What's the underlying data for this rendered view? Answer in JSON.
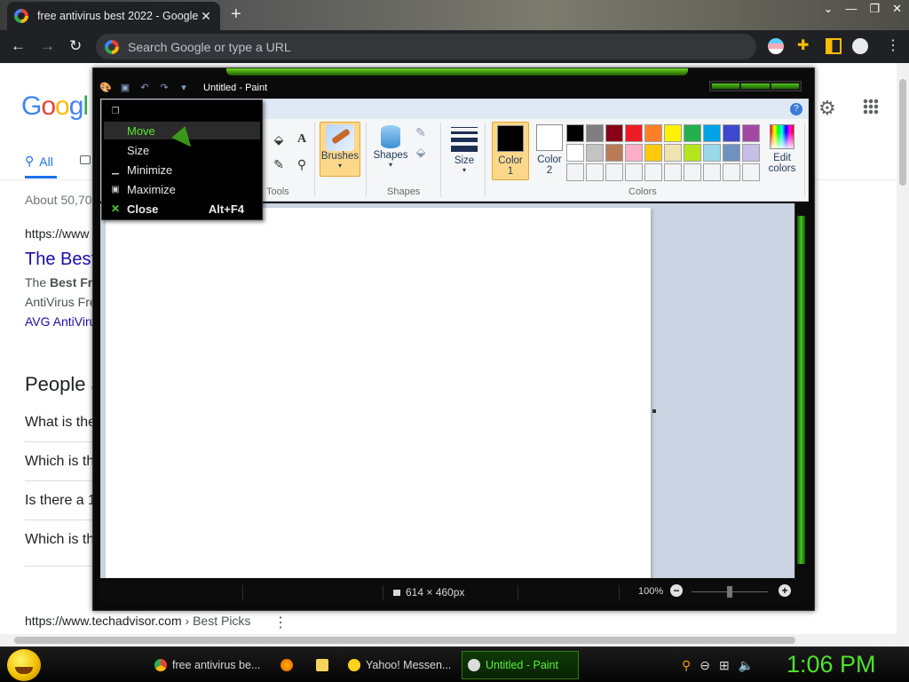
{
  "browser": {
    "tab_title": "free antivirus best 2022 - Google",
    "tab_close": "✕",
    "new_tab": "+",
    "omnibox_placeholder": "Search Google or type a URL",
    "back": "←",
    "forward": "→",
    "reload": "↻"
  },
  "google": {
    "logo": [
      "G",
      "o",
      "o",
      "g",
      "l"
    ],
    "tab_all": "All",
    "about": "About 50,70",
    "result_url": "https://www",
    "result_title": "The Best",
    "snippet_prefix": "The ",
    "snippet_bold": "Best Fre",
    "snippet_line2": "AntiVirus Fre",
    "result_link": "AVG AntiViru",
    "people_also_ask": "People a",
    "questions": [
      "What is the",
      "Which is th",
      "Is there a 1",
      "Which is th"
    ],
    "result2_url": "https://www.techadvisor.com",
    "result2_crumb": " › Best Picks",
    "kebab": "⋮"
  },
  "paint": {
    "window_title": "Untitled - Paint",
    "groups": {
      "tools": "Tools",
      "shapes": "Shapes",
      "colors": "Colors"
    },
    "buttons": {
      "brushes": "Brushes",
      "shapes": "Shapes",
      "size": "Size",
      "color1": "Color",
      "color1_num": "1",
      "color2": "Color",
      "color2_num": "2",
      "edit_colors_1": "Edit",
      "edit_colors_2": "colors"
    },
    "palette": [
      "#000000",
      "#7f7f7f",
      "#880015",
      "#ed1c24",
      "#ff7f27",
      "#fff200",
      "#22b14c",
      "#00a2e8",
      "#3f48cc",
      "#a349a4",
      "#ffffff",
      "#c3c3c3",
      "#b97a57",
      "#ffaec9",
      "#ffc90e",
      "#efe4b0",
      "#b5e61d",
      "#99d9ea",
      "#7092be",
      "#c8bfe7",
      "#f2f4f7",
      "#f2f4f7",
      "#f2f4f7",
      "#f2f4f7",
      "#f2f4f7",
      "#f2f4f7",
      "#f2f4f7",
      "#f2f4f7",
      "#f2f4f7",
      "#f2f4f7"
    ],
    "color1": "#000000",
    "color2": "#ffffff",
    "status_size": "614 × 460px",
    "zoom": "100%"
  },
  "system_menu": {
    "restore": "",
    "move": "Move",
    "size": "Size",
    "minimize": "Minimize",
    "maximize": "Maximize",
    "close": "Close",
    "close_accel": "Alt+F4"
  },
  "taskbar": {
    "tasks": [
      "free antivirus be...",
      "Yahoo! Messen...",
      "Untitled - Paint"
    ],
    "clock": "1:06 PM"
  },
  "colors": {
    "accent_green": "#4fe12a",
    "link_blue": "#1a0dab",
    "google_blue": "#1a73e8"
  }
}
